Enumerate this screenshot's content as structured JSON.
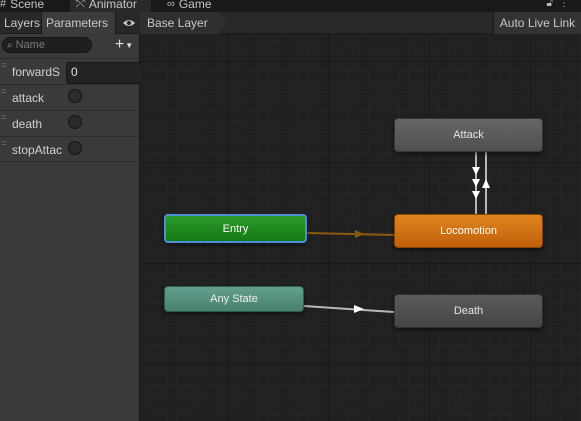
{
  "window_tabs": [
    {
      "label": "Scene",
      "icon": "grid-icon"
    },
    {
      "label": "Animator",
      "icon": "animator-icon"
    },
    {
      "label": "Game",
      "icon": "gamepad-icon"
    }
  ],
  "header": {
    "layers_label": "Layers",
    "parameters_label": "Parameters",
    "breadcrumb": "Base Layer",
    "auto_live_link_label": "Auto Live Link"
  },
  "search": {
    "placeholder": "Name",
    "value": ""
  },
  "parameters": [
    {
      "name": "forwardS",
      "type": "float",
      "value": "0"
    },
    {
      "name": "attack",
      "type": "trigger"
    },
    {
      "name": "death",
      "type": "trigger"
    },
    {
      "name": "stopAttac",
      "type": "trigger"
    }
  ],
  "states": {
    "attack": "Attack",
    "locomotion": "Locomotion",
    "entry": "Entry",
    "any_state": "Any State",
    "death": "Death"
  },
  "colors": {
    "entry": "#1f8a1f",
    "locomotion": "#d06d12",
    "any_state": "#5a9080",
    "default_state": "#505050",
    "selection": "#4f8fd8"
  }
}
